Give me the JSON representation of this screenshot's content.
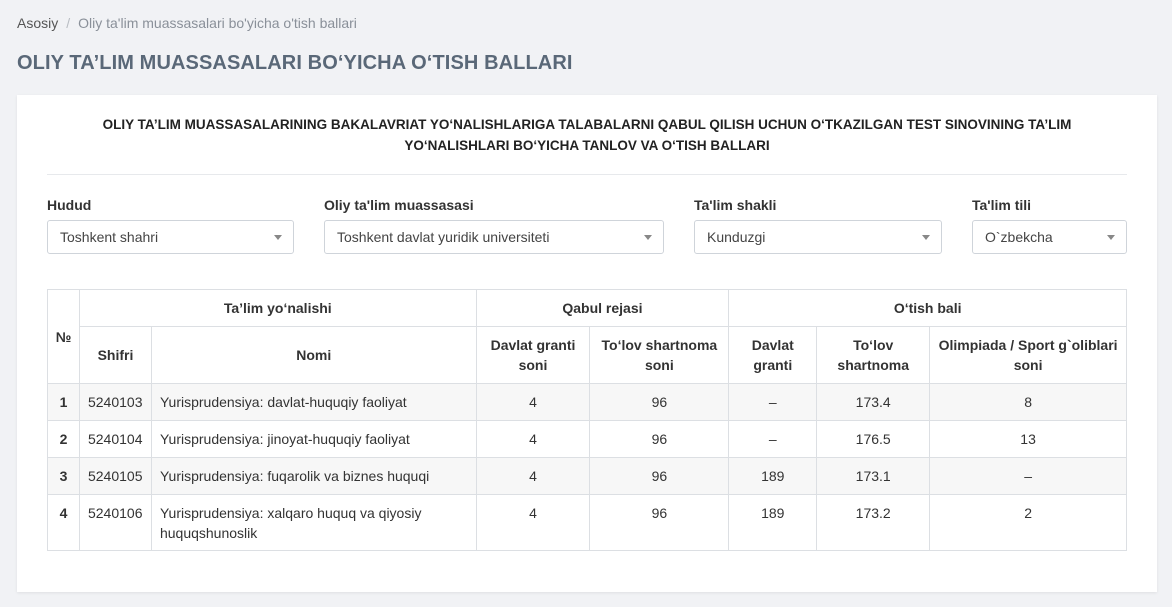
{
  "breadcrumb": {
    "home": "Asosiy",
    "separator": "/",
    "current": "Oliy ta'lim muassasalari bo'yicha o'tish ballari"
  },
  "page_title": "OLIY TA’LIM MUASSASALARI BO‘YICHA O‘TISH BALLARI",
  "heading": {
    "line1": "OLIY TA’LIM MUASSASALARINING  BAKALAVRIAT YO‘NALISHLARIGA TALABALARNI QABUL QILISH UCHUN O‘TKAZILGAN TEST SINOVINING TA’LIM",
    "line2": "YO‘NALISHLARI BO‘YICHA TANLOV VA O‘TISH BALLARI"
  },
  "filters": {
    "hudud": {
      "label": "Hudud",
      "value": "Toshkent shahri"
    },
    "otm": {
      "label": "Oliy ta'lim muassasasi",
      "value": "Toshkent davlat yuridik universiteti"
    },
    "shakl": {
      "label": "Ta'lim shakli",
      "value": "Kunduzgi"
    },
    "til": {
      "label": "Ta'lim tili",
      "value": "O`zbekcha"
    }
  },
  "table": {
    "headers": {
      "num": "№",
      "yonalish": "Ta’lim yo‘nalishi",
      "qabul": "Qabul rejasi",
      "otish": "O‘tish bali",
      "shifri": "Shifri",
      "nomi": "Nomi",
      "davlat_granti_soni": "Davlat granti soni",
      "tolov_shartnoma_soni": "To‘lov shartnoma soni",
      "davlat_granti": "Davlat granti",
      "tolov_shartnoma": "To‘lov shartnoma",
      "olimpiada": "Olimpiada / Sport g`oliblari soni"
    },
    "rows": [
      {
        "num": "1",
        "shifri": "5240103",
        "nomi": "Yurisprudensiya: davlat-huquqiy faoliyat",
        "grant_soni": "4",
        "shartnoma_soni": "96",
        "grant_bali": "–",
        "shartnoma_bali": "173.4",
        "olimpiada": "8"
      },
      {
        "num": "2",
        "shifri": "5240104",
        "nomi": "Yurisprudensiya: jinoyat-huquqiy faoliyat",
        "grant_soni": "4",
        "shartnoma_soni": "96",
        "grant_bali": "–",
        "shartnoma_bali": "176.5",
        "olimpiada": "13"
      },
      {
        "num": "3",
        "shifri": "5240105",
        "nomi": "Yurisprudensiya: fuqarolik va biznes huquqi",
        "grant_soni": "4",
        "shartnoma_soni": "96",
        "grant_bali": "189",
        "shartnoma_bali": "173.1",
        "olimpiada": "–"
      },
      {
        "num": "4",
        "shifri": "5240106",
        "nomi": "Yurisprudensiya: xalqaro huquq va qiyosiy huquqshunoslik",
        "grant_soni": "4",
        "shartnoma_soni": "96",
        "grant_bali": "189",
        "shartnoma_bali": "173.2",
        "olimpiada": "2"
      }
    ]
  }
}
